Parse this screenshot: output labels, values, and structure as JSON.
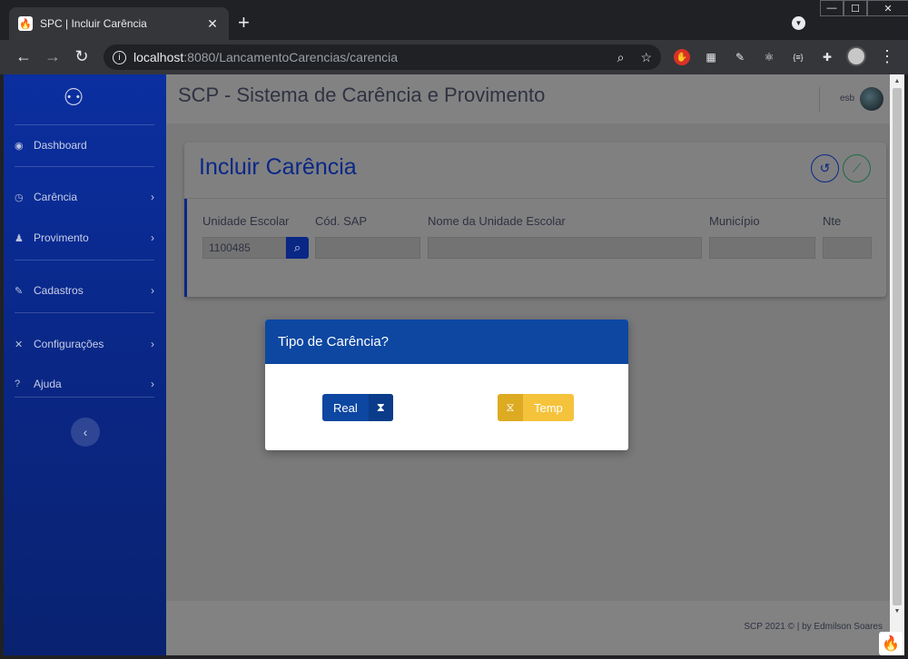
{
  "browser": {
    "tab_title": "SPC | Incluir Carência",
    "tab_close": "✕",
    "new_tab": "+",
    "url_host": "localhost",
    "url_path": ":8080/LancamentoCarencias/carencia",
    "window_controls": {
      "minimize": "—",
      "maximize": "☐",
      "close": "✕"
    }
  },
  "sidebar": {
    "items": [
      {
        "label": "Dashboard",
        "icon": "dashboard-icon"
      },
      {
        "label": "Carência",
        "icon": "clock-icon"
      },
      {
        "label": "Provimento",
        "icon": "user-tie-icon"
      },
      {
        "label": "Cadastros",
        "icon": "file-edit-icon"
      },
      {
        "label": "Configurações",
        "icon": "tools-icon"
      },
      {
        "label": "Ajuda",
        "icon": "question-icon"
      }
    ]
  },
  "header": {
    "app_title": "SCP - Sistema de Carência e Provimento",
    "user": "esb"
  },
  "card": {
    "title": "Incluir Carência",
    "fields": {
      "unidade_escolar": {
        "label": "Unidade Escolar",
        "value": "1100485"
      },
      "cod_sap": {
        "label": "Cód. SAP",
        "value": ""
      },
      "nome_unidade": {
        "label": "Nome da Unidade Escolar",
        "value": ""
      },
      "municipio": {
        "label": "Município",
        "value": ""
      },
      "nte": {
        "label": "Nte",
        "value": ""
      }
    }
  },
  "modal": {
    "title": "Tipo de Carência?",
    "real_label": "Real",
    "temp_label": "Temp"
  },
  "footer": {
    "text": "SCP 2021 © | by Edmilson Soares"
  },
  "colors": {
    "sidebar": "#0a2786",
    "modal_header": "#0d47a1",
    "temp_button": "#f5c33b",
    "real_button": "#0d47a1"
  }
}
